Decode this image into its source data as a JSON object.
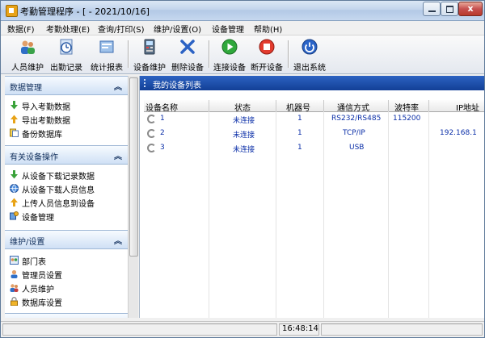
{
  "window": {
    "title": "考勤管理程序 - [ - 2021/10/16]",
    "close_glyph": "x"
  },
  "menu": [
    {
      "label": "数据(F)"
    },
    {
      "label": "考勤处理(E)"
    },
    {
      "label": "查询/打印(S)"
    },
    {
      "label": "维护/设置(O)"
    },
    {
      "label": "设备管理"
    },
    {
      "label": "帮助(H)"
    }
  ],
  "toolbar": {
    "buttons": [
      {
        "label": "人员维护",
        "icon": "users-icon"
      },
      {
        "label": "出勤记录",
        "icon": "clock-icon"
      },
      {
        "label": "统计报表",
        "icon": "report-icon"
      },
      {
        "label": "设备维护",
        "icon": "device-icon"
      },
      {
        "label": "删除设备",
        "icon": "delete-icon"
      },
      {
        "label": "连接设备",
        "icon": "play-icon"
      },
      {
        "label": "断开设备",
        "icon": "stop-icon"
      },
      {
        "label": "退出系统",
        "icon": "power-icon"
      }
    ]
  },
  "nav": {
    "groups": [
      {
        "title": "数据管理",
        "items": [
          {
            "label": "导入考勤数据",
            "icon": "arrow-down-icon"
          },
          {
            "label": "导出考勤数据",
            "icon": "arrow-up-icon"
          },
          {
            "label": "备份数据库",
            "icon": "backup-icon"
          }
        ]
      },
      {
        "title": "有关设备操作",
        "items": [
          {
            "label": "从设备下载记录数据",
            "icon": "arrow-down-icon"
          },
          {
            "label": "从设备下载人员信息",
            "icon": "globe-icon"
          },
          {
            "label": "上传人员信息到设备",
            "icon": "arrow-up-icon"
          },
          {
            "label": "设备管理",
            "icon": "device-manage-icon"
          }
        ]
      },
      {
        "title": "维护/设置",
        "items": [
          {
            "label": "部门表",
            "icon": "department-icon"
          },
          {
            "label": "管理员设置",
            "icon": "admin-icon"
          },
          {
            "label": "人员维护",
            "icon": "person-icon"
          },
          {
            "label": "数据库设置",
            "icon": "lock-icon"
          }
        ]
      }
    ],
    "chevron": "︽"
  },
  "main": {
    "header": "我的设备列表",
    "columns": [
      "设备名称",
      "状态",
      "机器号",
      "通信方式",
      "波特率",
      "IP地址"
    ],
    "rows": [
      {
        "name": "1",
        "status": "未连接",
        "machine": "1",
        "comm": "RS232/RS485",
        "baud": "115200",
        "ip": ""
      },
      {
        "name": "2",
        "status": "未连接",
        "machine": "1",
        "comm": "TCP/IP",
        "baud": "",
        "ip": "192.168.1"
      },
      {
        "name": "3",
        "status": "未连接",
        "machine": "1",
        "comm": "USB",
        "baud": "",
        "ip": ""
      }
    ]
  },
  "status": {
    "time": "16:48:14"
  },
  "colors": {
    "header_blue": "#1a4aa6",
    "link_blue": "#0b2fa8"
  }
}
